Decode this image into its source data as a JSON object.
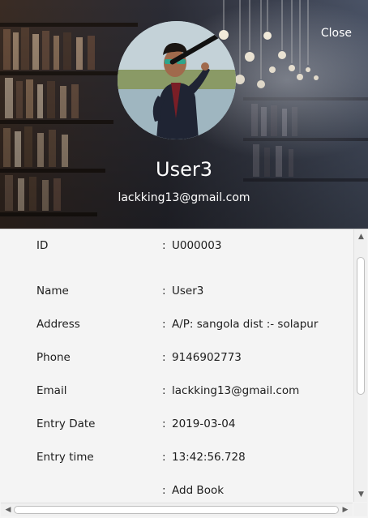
{
  "header": {
    "close_label": "Close",
    "user_name": "User3",
    "user_email": "lackking13@gmail.com"
  },
  "details": {
    "separator": ":",
    "rows": [
      {
        "label": "ID",
        "value": "U000003"
      },
      {
        "label": "Name",
        "value": "User3"
      },
      {
        "label": "Address",
        "value": "A/P: sangola dist :-  solapur"
      },
      {
        "label": "Phone",
        "value": "9146902773"
      },
      {
        "label": "Email",
        "value": "lackking13@gmail.com"
      },
      {
        "label": "Entry Date",
        "value": "2019-03-04"
      },
      {
        "label": "Entry time",
        "value": "13:42:56.728"
      },
      {
        "label": "",
        "value": "Add Book"
      }
    ]
  },
  "scrollbars": {
    "vertical_up_icon": "triangle-up-icon",
    "vertical_down_icon": "triangle-down-icon",
    "horizontal_left_icon": "triangle-left-icon",
    "horizontal_right_icon": "triangle-right-icon"
  }
}
